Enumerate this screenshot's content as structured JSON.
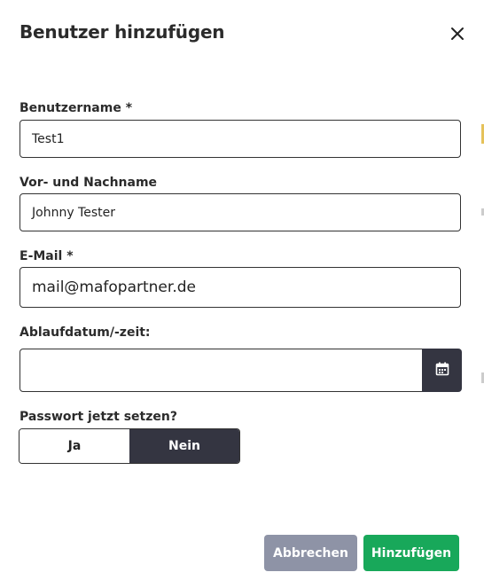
{
  "dialog": {
    "title": "Benutzer hinzufügen",
    "close_icon": "close-icon"
  },
  "fields": {
    "username": {
      "label": "Benutzername *",
      "value": "Test1"
    },
    "fullname": {
      "label": "Vor- und Nachname",
      "value": "Johnny Tester"
    },
    "email": {
      "label": "E-Mail *",
      "value": "mail@mafopartner.de"
    },
    "expiry": {
      "label": "Ablaufdatum/-zeit:",
      "value": "",
      "icon": "calendar-icon"
    }
  },
  "password": {
    "label": "Passwort jetzt setzen?",
    "options": [
      "Ja",
      "Nein"
    ],
    "selected": "Nein"
  },
  "actions": {
    "cancel_label": "Abbrechen",
    "add_label": "Hinzufügen"
  },
  "colors": {
    "dark": "#343541",
    "cancel": "#8e93a6",
    "primary": "#18a85a"
  }
}
